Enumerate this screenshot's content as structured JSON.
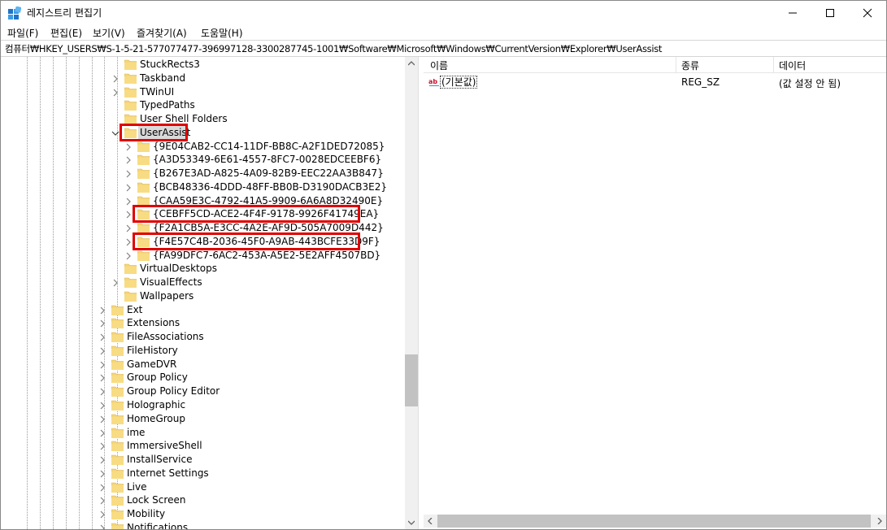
{
  "window": {
    "title": "레지스트리 편집기",
    "minimize_glyph": "—",
    "maximize_glyph": "☐",
    "close_glyph": "✕"
  },
  "menu": [
    {
      "label": "파일(F)"
    },
    {
      "label": "편집(E)"
    },
    {
      "label": "보기(V)"
    },
    {
      "label": "즐겨찾기(A)"
    },
    {
      "label": "도움말(H)"
    }
  ],
  "address": "컴퓨터₩HKEY_USERS₩S-1-5-21-577077477-396997128-3300287745-1001₩Software₩Microsoft₩Windows₩CurrentVersion₩Explorer₩UserAssist",
  "tree": {
    "explorer_children_before": [
      {
        "label": "StuckRects3",
        "expandable": false
      },
      {
        "label": "Taskband",
        "expandable": true
      },
      {
        "label": "TWinUI",
        "expandable": true
      },
      {
        "label": "TypedPaths",
        "expandable": false
      },
      {
        "label": "User Shell Folders",
        "expandable": false
      }
    ],
    "selected": {
      "label": "UserAssist",
      "expanded": true,
      "highlighted": true
    },
    "userassist_children": [
      {
        "label": "{9E04CAB2-CC14-11DF-BB8C-A2F1DED72085}",
        "highlighted": false
      },
      {
        "label": "{A3D53349-6E61-4557-8FC7-0028EDCEEBF6}",
        "highlighted": false
      },
      {
        "label": "{B267E3AD-A825-4A09-82B9-EEC22AA3B847}",
        "highlighted": false
      },
      {
        "label": "{BCB48336-4DDD-48FF-BB0B-D3190DACB3E2}",
        "highlighted": false
      },
      {
        "label": "{CAA59E3C-4792-41A5-9909-6A6A8D32490E}",
        "highlighted": false
      },
      {
        "label": "{CEBFF5CD-ACE2-4F4F-9178-9926F41749EA}",
        "highlighted": true
      },
      {
        "label": "{F2A1CB5A-E3CC-4A2E-AF9D-505A7009D442}",
        "highlighted": false
      },
      {
        "label": "{F4E57C4B-2036-45F0-A9AB-443BCFE33D9F}",
        "highlighted": true
      },
      {
        "label": "{FA99DFC7-6AC2-453A-A5E2-5E2AFF4507BD}",
        "highlighted": false
      }
    ],
    "explorer_children_after": [
      {
        "label": "VirtualDesktops",
        "expandable": false
      },
      {
        "label": "VisualEffects",
        "expandable": true
      },
      {
        "label": "Wallpapers",
        "expandable": false
      }
    ],
    "windows_children": [
      {
        "label": "Ext"
      },
      {
        "label": "Extensions"
      },
      {
        "label": "FileAssociations"
      },
      {
        "label": "FileHistory"
      },
      {
        "label": "GameDVR"
      },
      {
        "label": "Group Policy"
      },
      {
        "label": "Group Policy Editor"
      },
      {
        "label": "Holographic"
      },
      {
        "label": "HomeGroup"
      },
      {
        "label": "ime"
      },
      {
        "label": "ImmersiveShell"
      },
      {
        "label": "InstallService"
      },
      {
        "label": "Internet Settings"
      },
      {
        "label": "Live"
      },
      {
        "label": "Lock Screen"
      },
      {
        "label": "Mobility"
      },
      {
        "label": "Notifications"
      }
    ]
  },
  "list": {
    "columns": {
      "name": "이름",
      "type": "종류",
      "data": "데이터"
    },
    "rows": [
      {
        "name": "(기본값)",
        "type": "REG_SZ",
        "data": "(값 설정 안 됨)",
        "icon": "string-value-icon"
      }
    ]
  },
  "colors": {
    "highlight_border": "#e00000",
    "folder": "#f6d67a"
  }
}
